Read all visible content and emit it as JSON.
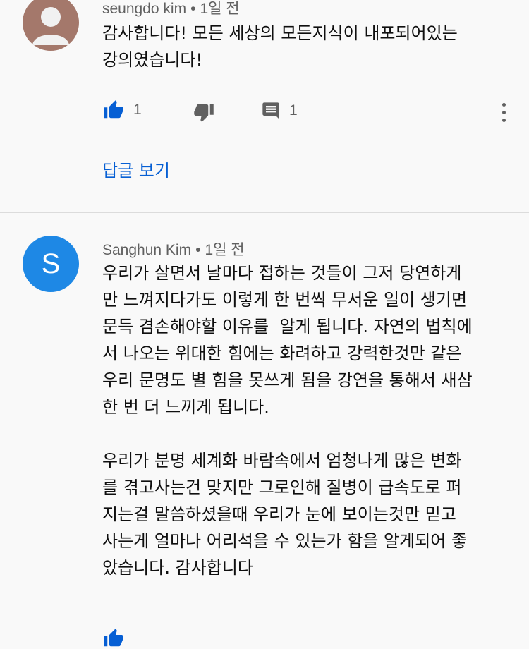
{
  "comments": [
    {
      "author": "seungdo kim",
      "time": "1일 전",
      "text_lines": [
        "감사합니다! 모든 세상의 모든지식이 내포되어있는",
        "강의였습니다!"
      ],
      "likes": "1",
      "reply_count": "1",
      "view_replies": "답글 보기",
      "like_icon": "thumbs-up-filled-icon",
      "dislike_icon": "thumbs-down-icon",
      "reply_icon": "comment-icon",
      "more_icon": "more-vert-icon"
    },
    {
      "author": "Sanghun Kim",
      "time": "1일 전",
      "avatar_letter": "S",
      "text_lines": [
        "우리가 살면서 날마다 접하는 것들이 그저 당연하게",
        "만 느껴지다가도 이렇게 한 번씩 무서운 일이 생기면",
        "문득 겸손해야할 이유를  알게 됩니다. 자연의 법칙에",
        "서 나오는 위대한 힘에는 화려하고 강력한것만 같은",
        "우리 문명도 별 힘을 못쓰게 됨을 강연을 통해서 새삼",
        "한 번 더 느끼게 됩니다.",
        "",
        "우리가 분명 세계화 바람속에서 엄청나게 많은 변화",
        "를 겪고사는건 맞지만 그로인해 질병이 급속도로 퍼",
        "지는걸 말씀하셨을때 우리가 눈에 보이는것만 믿고",
        "사는게 얼마나 어리석을 수 있는가 함을 알게되어 좋",
        "았습니다. 감사합니다"
      ]
    }
  ],
  "colors": {
    "background": "#f9f9f9",
    "link": "#065fd4",
    "like_active": "#065fd4",
    "icon": "#606060",
    "avatar_s": "#1e88e5"
  }
}
